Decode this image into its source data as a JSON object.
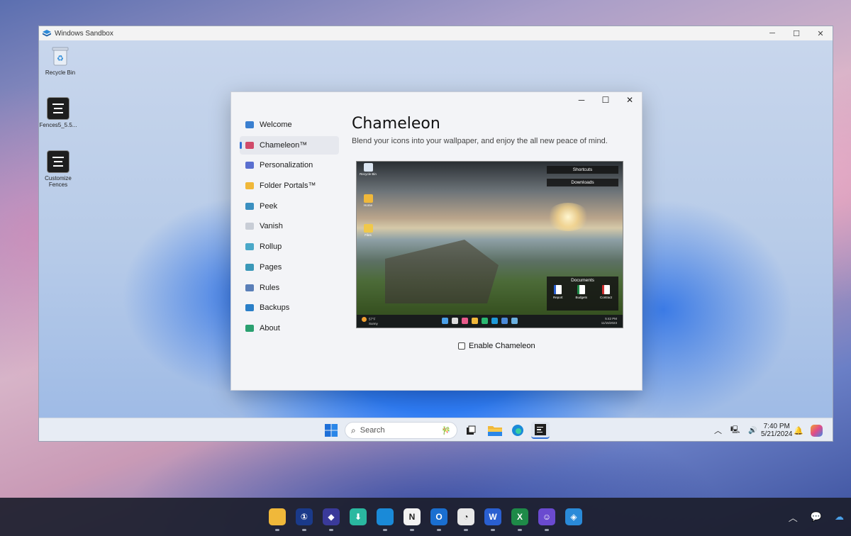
{
  "sandbox": {
    "title": "Windows Sandbox",
    "controls": {
      "minimize": "─",
      "maximize": "☐",
      "close": "✕"
    }
  },
  "desktop_icons": [
    {
      "label": "Recycle Bin"
    },
    {
      "label": "Fences5_5.5..."
    },
    {
      "label": "Customize Fences"
    }
  ],
  "fences_window": {
    "controls": {
      "minimize": "─",
      "maximize": "☐",
      "close": "✕"
    },
    "nav": [
      {
        "label": "Welcome",
        "color": "#3a7fd0"
      },
      {
        "label": "Chameleon™",
        "color": "#d04a6a",
        "active": true
      },
      {
        "label": "Personalization",
        "color": "#5a6fd0"
      },
      {
        "label": "Folder Portals™",
        "color": "#f0b83a"
      },
      {
        "label": "Peek",
        "color": "#3a8fc0"
      },
      {
        "label": "Vanish",
        "color": "#c8cdd6"
      },
      {
        "label": "Rollup",
        "color": "#4aa8c8"
      },
      {
        "label": "Pages",
        "color": "#3a98b8"
      },
      {
        "label": "Rules",
        "color": "#5a7fb8"
      },
      {
        "label": "Backups",
        "color": "#2a7fc8"
      },
      {
        "label": "About",
        "color": "#2aa070"
      }
    ],
    "title": "Chameleon",
    "subtitle": "Blend your icons into your wallpaper, and enjoy the all new peace of mind.",
    "preview": {
      "fences": {
        "shortcuts": "Shortcuts",
        "downloads": "Downloads",
        "documents": "Documents"
      },
      "docs": [
        "Report",
        "Budgets",
        "Contract"
      ],
      "desktop_icons": [
        "Recycle Bin",
        "Home",
        "Files"
      ],
      "weather": {
        "temp": "57°F",
        "cond": "Sunny"
      },
      "clock": {
        "time": "5:42 PM",
        "date": "11/15/2023"
      }
    },
    "checkbox_label": "Enable Chameleon",
    "checkbox_checked": false
  },
  "sandbox_taskbar": {
    "search_placeholder": "Search",
    "time": "7:40 PM",
    "date": "5/21/2024"
  },
  "host_taskbar": {
    "apps": [
      "File Explorer",
      "1Password",
      "App",
      "Downloads",
      "Edge",
      "Notion",
      "Outlook New",
      "Clock",
      "Word",
      "Excel",
      "Robot",
      "Sandbox"
    ]
  },
  "accent": "#2f6fd6"
}
